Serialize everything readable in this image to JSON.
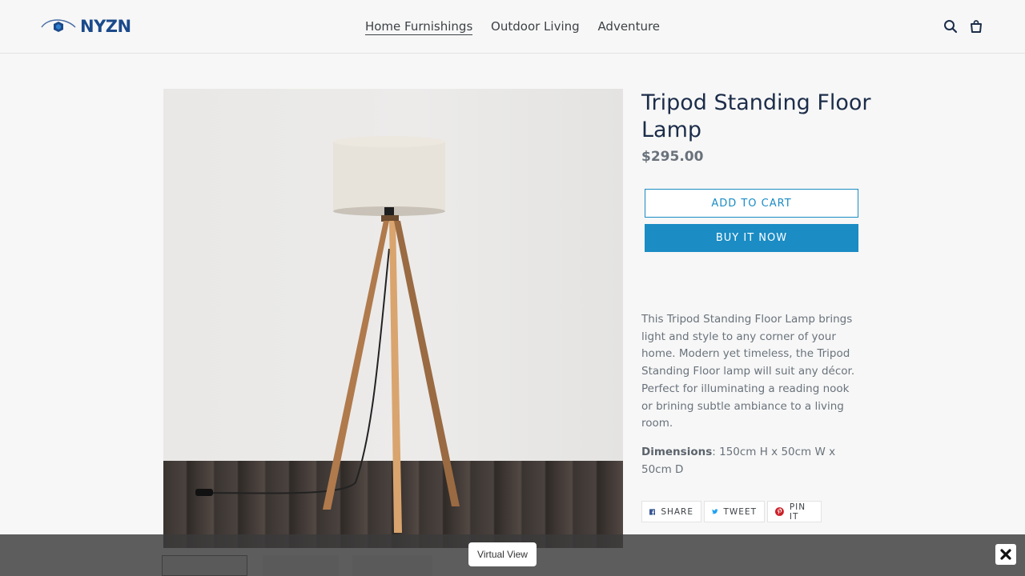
{
  "brand": {
    "name": "NYZN"
  },
  "nav": {
    "items": [
      "Home Furnishings",
      "Outdoor Living",
      "Adventure"
    ],
    "active": "Home Furnishings"
  },
  "header_icons": [
    "search-icon",
    "cart-icon"
  ],
  "product": {
    "title": "Tripod Standing Floor Lamp",
    "price": "$295.00",
    "add_to_cart": "ADD TO CART",
    "buy_now": "BUY IT NOW",
    "description": "This Tripod Standing Floor Lamp brings light and style to any corner of your home. Modern yet timeless, the Tripod Standing Floor lamp will suit any décor. Perfect for illuminating a reading nook or brining subtle ambiance to a living room.",
    "dimensions_label": "Dimensions",
    "dimensions_value": ": 150cm H x 50cm W x 50cm D"
  },
  "share": {
    "share": "SHARE",
    "tweet": "TWEET",
    "pin": "PIN IT"
  },
  "overlay": {
    "virtual_view": "Virtual View",
    "close_icon": "close-icon"
  },
  "colors": {
    "accent": "#1b8cc4",
    "title": "#1c2d4a",
    "text": "#69727b",
    "brand": "#1a4a8a"
  }
}
